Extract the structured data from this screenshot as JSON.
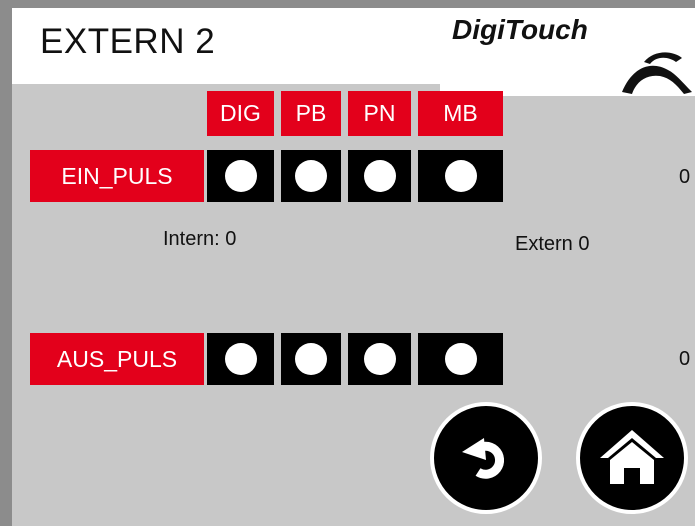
{
  "header": {
    "title": "EXTERN 2",
    "logo_text": "DigiTouch"
  },
  "columns": [
    "DIG",
    "PB",
    "PN",
    "MB"
  ],
  "rows": [
    {
      "label": "EIN_PULS",
      "value": "0"
    },
    {
      "label": "AUS_PULS",
      "value": "0"
    }
  ],
  "status": {
    "intern": "Intern: 0",
    "extern": "Extern 0"
  },
  "nav": {
    "back_icon": "back-arrow-icon",
    "home_icon": "home-icon"
  },
  "colors": {
    "accent": "#e3001b",
    "background": "#c8c8c8",
    "lamp_off": "#000000",
    "lamp_dot": "#ffffff"
  }
}
